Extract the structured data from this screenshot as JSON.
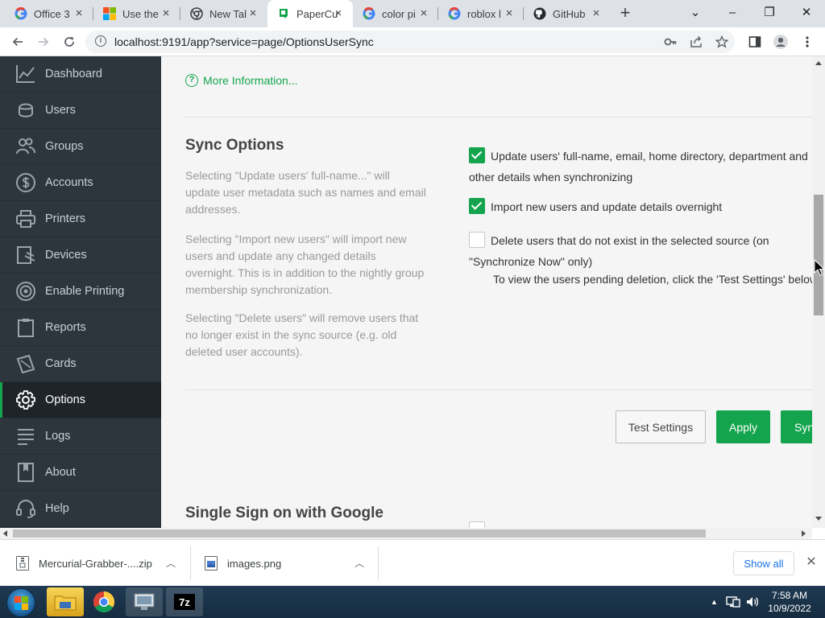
{
  "browser": {
    "tabs": [
      {
        "title": "Office 3",
        "favicon": "google-g-icon",
        "active": false
      },
      {
        "title": "Use the",
        "favicon": "microsoft-logo-icon",
        "active": false
      },
      {
        "title": "New Tal",
        "favicon": "chrome-icon",
        "active": false
      },
      {
        "title": "PaperCu",
        "favicon": "papercut-icon",
        "active": true
      },
      {
        "title": "color pi",
        "favicon": "google-g-icon",
        "active": false
      },
      {
        "title": "roblox l",
        "favicon": "google-g-icon",
        "active": false
      },
      {
        "title": "GitHub",
        "favicon": "github-icon",
        "active": false
      }
    ],
    "new_tab": "+",
    "window_controls": {
      "minimize": "–",
      "restore": "❐",
      "close": "✕",
      "tab_search": "⌄"
    },
    "url": "localhost:9191/app?service=page/OptionsUserSync"
  },
  "sidebar": {
    "items": [
      {
        "label": "Dashboard",
        "icon": "dashboard-chart-icon",
        "active": false
      },
      {
        "label": "Users",
        "icon": "user-icon",
        "active": false
      },
      {
        "label": "Groups",
        "icon": "group-icon",
        "active": false
      },
      {
        "label": "Accounts",
        "icon": "dollar-icon",
        "active": false
      },
      {
        "label": "Printers",
        "icon": "printer-icon",
        "active": false
      },
      {
        "label": "Devices",
        "icon": "device-icon",
        "active": false
      },
      {
        "label": "Enable Printing",
        "icon": "target-icon",
        "active": false
      },
      {
        "label": "Reports",
        "icon": "clipboard-icon",
        "active": false
      },
      {
        "label": "Cards",
        "icon": "card-icon",
        "active": false
      },
      {
        "label": "Options",
        "icon": "gear-icon",
        "active": true
      },
      {
        "label": "Logs",
        "icon": "list-icon",
        "active": false
      },
      {
        "label": "About",
        "icon": "book-icon",
        "active": false
      },
      {
        "label": "Help",
        "icon": "headset-icon",
        "active": false
      }
    ]
  },
  "main": {
    "more_info": "More Information...",
    "sync": {
      "title": "Sync Options",
      "help": [
        "Selecting \"Update users' full-name...\" will update user metadata such as names and email addresses.",
        "Selecting \"Import new users\" will import new users and update any changed details overnight. This is in addition to the nightly group membership synchronization.",
        "Selecting \"Delete users\" will remove users that no longer exist in the sync source (e.g. old deleted user accounts)."
      ],
      "options": [
        {
          "label": "Update users' full-name, email, home directory, department and other details when synchronizing",
          "checked": true
        },
        {
          "label": "Import new users and update details overnight",
          "checked": true
        },
        {
          "label": "Delete users that do not exist in the selected source (on \"Synchronize Now\" only)",
          "checked": false
        }
      ],
      "delete_note": "To view the users pending deletion, click the 'Test Settings' below."
    },
    "buttons": {
      "test": "Test Settings",
      "apply": "Apply",
      "sync": "Synchronize Now"
    },
    "sso": {
      "title": "Single Sign on with Google"
    }
  },
  "downloads": {
    "items": [
      {
        "name": "Mercurial-Grabber-....zip",
        "icon": "zip-file-icon"
      },
      {
        "name": "images.png",
        "icon": "image-file-icon"
      }
    ],
    "show_all": "Show all"
  },
  "taskbar": {
    "time": "7:58 AM",
    "date": "10/9/2022"
  },
  "colors": {
    "accent": "#14a44d",
    "sidebar_bg": "#2e363d",
    "content_bg": "#f5f5f5"
  }
}
